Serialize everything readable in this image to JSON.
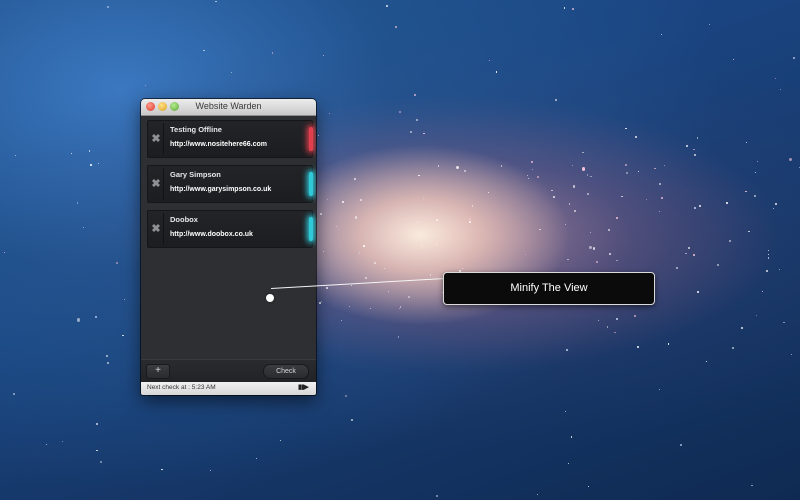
{
  "window": {
    "title": "Website Warden",
    "sites": [
      {
        "name": "Testing Offline",
        "url": "http://www.nositehere66.com",
        "status_color": "#e0404d"
      },
      {
        "name": "Gary Simpson",
        "url": "http://www.garysimpson.co.uk",
        "status_color": "#2fc9d8"
      },
      {
        "name": "Doobox",
        "url": "http://www.doobox.co.uk",
        "status_color": "#2fc9d8"
      }
    ],
    "remove_glyph": "✖",
    "add_label": "+",
    "check_label": "Check",
    "next_check_text": "Next check at : 5:23 AM",
    "playback_glyph": "▮▮▶"
  },
  "callout": {
    "text": "Minify The View"
  }
}
